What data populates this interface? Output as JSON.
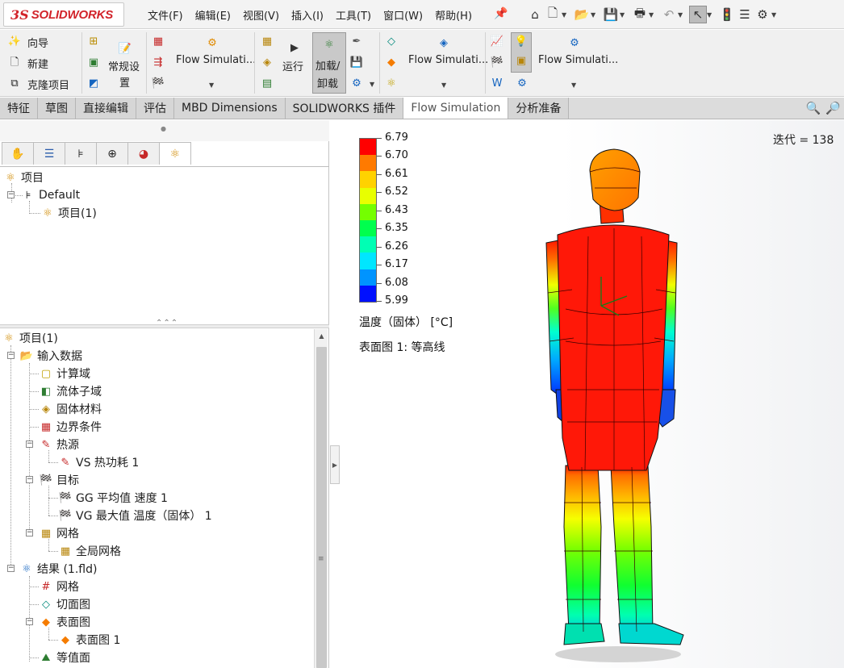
{
  "app": {
    "logo_mark": "3S",
    "logo_text": "SOLIDWORKS"
  },
  "menu": [
    "文件(F)",
    "编辑(E)",
    "视图(V)",
    "插入(I)",
    "工具(T)",
    "窗口(W)",
    "帮助(H)"
  ],
  "quick_access": [
    "home-icon",
    "new-document-icon",
    "open-icon",
    "save-icon",
    "print-icon",
    "undo-icon",
    "select-pointer-icon",
    "traffic-light-icon",
    "options-list-icon",
    "gear-icon"
  ],
  "ribbon": {
    "wizard": "向导",
    "new": "新建",
    "clone": "克隆项目",
    "general_settings_line1": "常规设",
    "general_settings_line2": "置",
    "flow_sim_1": "Flow Simulati...",
    "run": "运行",
    "load_line1": "加载/",
    "load_line2": "卸载",
    "flow_sim_2": "Flow Simulati...",
    "flow_sim_3": "Flow Simulati..."
  },
  "tabs": [
    {
      "label": "特征",
      "active": false
    },
    {
      "label": "草图",
      "active": false
    },
    {
      "label": "直接编辑",
      "active": false
    },
    {
      "label": "评估",
      "active": false
    },
    {
      "label": "MBD Dimensions",
      "active": false
    },
    {
      "label": "SOLIDWORKS 插件",
      "active": false
    },
    {
      "label": "Flow Simulation",
      "active": true
    },
    {
      "label": "分析准备",
      "active": false
    }
  ],
  "top_tree": {
    "root": "项目",
    "config": "Default",
    "project": "项目(1)"
  },
  "bottom_tree": {
    "root": "项目(1)",
    "input_data": "输入数据",
    "computational_domain": "计算域",
    "fluid_subdomain": "流体子域",
    "solid_material": "固体材料",
    "boundary_conditions": "边界条件",
    "heat_sources": "热源",
    "vs_heat": "VS 热功耗 1",
    "goals": "目标",
    "gg_goal": "GG 平均值 速度 1",
    "vg_goal": "VG 最大值 温度（固体） 1",
    "mesh": "网格",
    "global_mesh": "全局网格",
    "results": "结果 (1.fld)",
    "results_mesh": "网格",
    "cut_plots": "切面图",
    "surface_plots": "表面图",
    "surface_plot_1": "表面图 1",
    "isosurfaces": "等值面"
  },
  "viewport": {
    "iteration": "迭代 = 138",
    "legend_title": "温度（固体）  [°C]",
    "plot_title": "表面图 1: 等高线"
  },
  "legend": {
    "labels": [
      "6.79",
      "6.70",
      "6.61",
      "6.52",
      "6.43",
      "6.35",
      "6.26",
      "6.17",
      "6.08",
      "5.99"
    ],
    "colors": [
      "#ff0000",
      "#ff7a00",
      "#ffd200",
      "#e8ff00",
      "#74ff00",
      "#00ff4e",
      "#00ffb4",
      "#00e6ff",
      "#0094ff",
      "#0010ff"
    ]
  },
  "colors": {
    "brand": "#d2232a",
    "panel": "#f0f0f0"
  }
}
